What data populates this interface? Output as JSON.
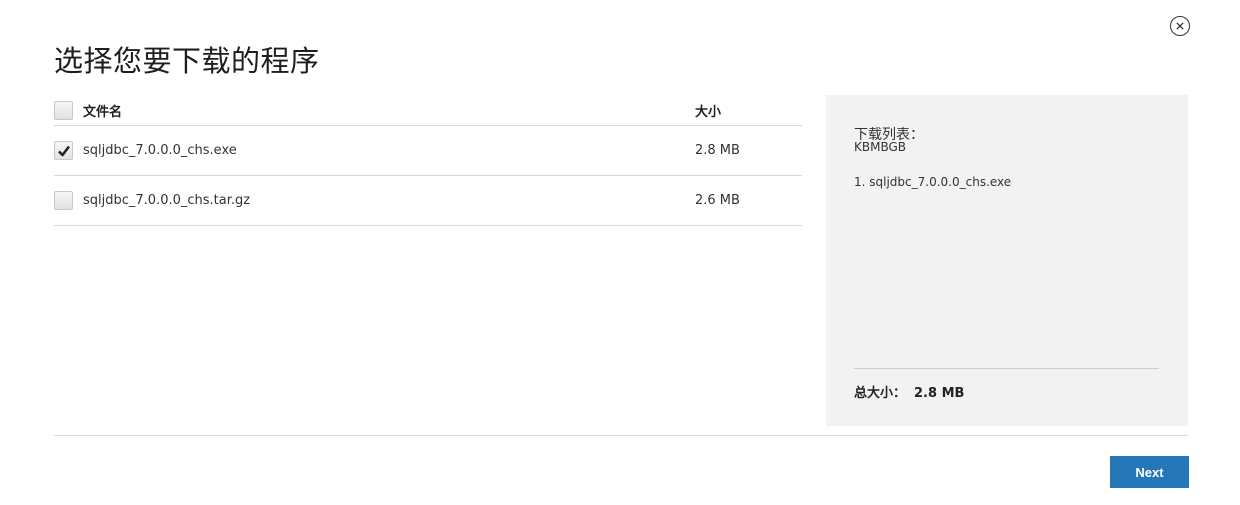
{
  "dialog": {
    "title": "选择您要下载的程序",
    "close_icon": "close-circle-icon"
  },
  "table": {
    "columns": {
      "name": "文件名",
      "size": "大小"
    },
    "header_checked": false,
    "rows": [
      {
        "name": "sqljdbc_7.0.0.0_chs.exe",
        "size": "2.8 MB",
        "checked": true
      },
      {
        "name": "sqljdbc_7.0.0.0_chs.tar.gz",
        "size": "2.6 MB",
        "checked": false
      }
    ]
  },
  "summary": {
    "heading": "下载列表：",
    "subheading": "KBMBGB",
    "items": [
      "1. sqljdbc_7.0.0.0_chs.exe"
    ],
    "total_label": "总大小：",
    "total_value": "2.8 MB"
  },
  "footer": {
    "next_label": "Next"
  },
  "colors": {
    "accent": "#2677b8",
    "panel_bg": "#f2f2f2"
  }
}
